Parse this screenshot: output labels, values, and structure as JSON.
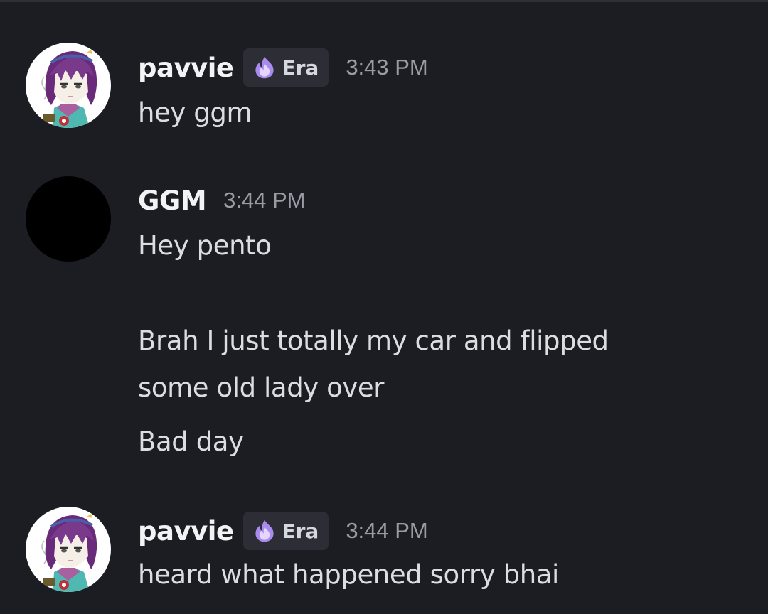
{
  "colors": {
    "background": "#1c1d22",
    "username": "#f2f3f5",
    "message_text": "#dcdde1",
    "timestamp": "#9a9ca4",
    "tag_background": "#2d2e35",
    "tag_icon": "#a98bf0"
  },
  "messages": [
    {
      "author": "pavvie",
      "tag": {
        "icon": "purple-flame-icon",
        "label": "Era"
      },
      "timestamp": "3:43 PM",
      "avatar": "anime-girl-avatar",
      "lines": [
        "hey ggm"
      ]
    },
    {
      "author": "GGM",
      "timestamp": "3:44 PM",
      "avatar": "black-avatar",
      "lines": [
        "Hey pento",
        "Brah I just totally my car and flipped",
        "some old lady over",
        "Bad day"
      ]
    },
    {
      "author": "pavvie",
      "tag": {
        "icon": "purple-flame-icon",
        "label": "Era"
      },
      "timestamp": "3:44 PM",
      "avatar": "anime-girl-avatar",
      "lines": [
        "heard what happened sorry bhai"
      ]
    }
  ]
}
